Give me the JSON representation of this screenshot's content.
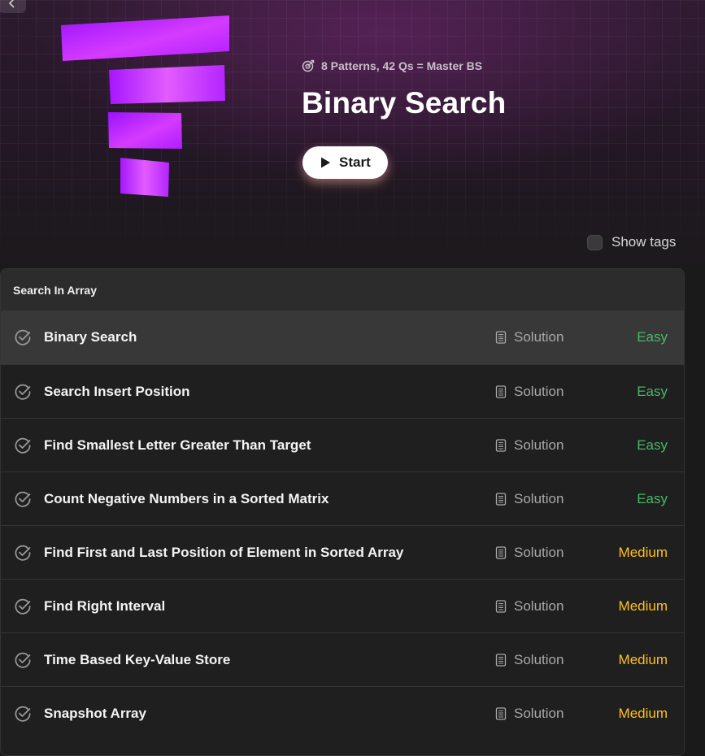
{
  "header": {
    "meta_text": "8 Patterns, 42 Qs = Master BS",
    "title": "Binary Search",
    "start_label": "Start",
    "show_tags_label": "Show tags",
    "show_tags_checked": false
  },
  "section": {
    "name": "Search In Array",
    "questions": [
      {
        "title": "Binary Search",
        "solution_label": "Solution",
        "difficulty": "Easy",
        "active": true
      },
      {
        "title": "Search Insert Position",
        "solution_label": "Solution",
        "difficulty": "Easy"
      },
      {
        "title": "Find Smallest Letter Greater Than Target",
        "solution_label": "Solution",
        "difficulty": "Easy"
      },
      {
        "title": "Count Negative Numbers in a Sorted Matrix",
        "solution_label": "Solution",
        "difficulty": "Easy"
      },
      {
        "title": "Find First and Last Position of Element in Sorted Array",
        "solution_label": "Solution",
        "difficulty": "Medium"
      },
      {
        "title": "Find Right Interval",
        "solution_label": "Solution",
        "difficulty": "Medium"
      },
      {
        "title": "Time Based Key-Value Store",
        "solution_label": "Solution",
        "difficulty": "Medium"
      },
      {
        "title": "Snapshot Array",
        "solution_label": "Solution",
        "difficulty": "Medium"
      }
    ]
  },
  "colors": {
    "easy": "#49b76a",
    "medium": "#ffc01e",
    "logo_gradient": [
      "#a818ff",
      "#e44bff"
    ]
  },
  "icons": {
    "back": "chevron-left-icon",
    "meta": "target-icon",
    "start": "play-icon",
    "row_check": "check-circle-icon",
    "solution": "document-icon"
  }
}
